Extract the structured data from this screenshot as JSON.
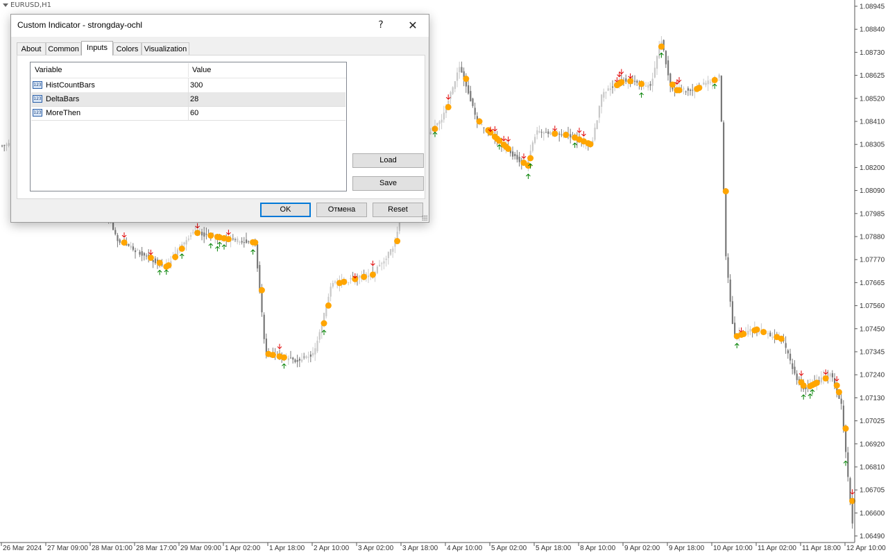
{
  "chart": {
    "symbol": "EURUSD,H1",
    "price_ticks": [
      "1.08945",
      "1.08840",
      "1.08730",
      "1.08625",
      "1.08520",
      "1.08410",
      "1.08305",
      "1.08200",
      "1.08090",
      "1.07985",
      "1.07880",
      "1.07770",
      "1.07665",
      "1.07560",
      "1.07450",
      "1.07345",
      "1.07240",
      "1.07130",
      "1.07025",
      "1.06920",
      "1.06810",
      "1.06705",
      "1.06600",
      "1.06490"
    ],
    "time_ticks": [
      "26 Mar 2024",
      "27 Mar 09:00",
      "28 Mar 01:00",
      "28 Mar 17:00",
      "29 Mar 09:00",
      "1 Apr 02:00",
      "1 Apr 18:00",
      "2 Apr 10:00",
      "3 Apr 02:00",
      "3 Apr 18:00",
      "4 Apr 10:00",
      "5 Apr 02:00",
      "5 Apr 18:00",
      "8 Apr 10:00",
      "9 Apr 02:00",
      "9 Apr 18:00",
      "10 Apr 10:00",
      "11 Apr 02:00",
      "11 Apr 18:00",
      "12 Apr 10:00"
    ],
    "colors": {
      "bull_candle": "#c8c8c8",
      "bear_candle": "#787878",
      "dot": "#ffa500",
      "arrow_up": "#008000",
      "arrow_down": "#e00000"
    }
  },
  "dialog": {
    "title": "Custom Indicator - strongday-ochl",
    "help_label": "?",
    "close_label": "✕",
    "tabs": [
      {
        "label": "About",
        "active": false
      },
      {
        "label": "Common",
        "active": false
      },
      {
        "label": "Inputs",
        "active": true
      },
      {
        "label": "Colors",
        "active": false
      },
      {
        "label": "Visualization",
        "active": false
      }
    ],
    "table": {
      "headers": {
        "variable": "Variable",
        "value": "Value"
      },
      "icon_text": "123",
      "rows": [
        {
          "variable": "HistCountBars",
          "value": "300"
        },
        {
          "variable": "DeltaBars",
          "value": "28"
        },
        {
          "variable": "MoreThen",
          "value": "60"
        }
      ]
    },
    "buttons": {
      "load": "Load",
      "save": "Save",
      "ok": "OK",
      "cancel": "Отмена",
      "reset": "Reset"
    }
  }
}
